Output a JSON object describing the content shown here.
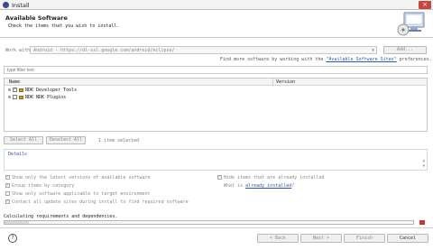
{
  "window": {
    "title": "Install",
    "close_glyph": "×"
  },
  "header": {
    "title": "Available Software",
    "subtitle": "Check the items that you wish to install."
  },
  "work_with": {
    "label": "Work with:",
    "value": "Android - https://dl-ssl.google.com/android/eclipse/",
    "add_label": "Add...",
    "find_more_prefix": "Find more software by working with the ",
    "find_more_link": "\"Available Software Sites\"",
    "find_more_suffix": " preferences."
  },
  "filter": {
    "placeholder": "type filter text"
  },
  "tree": {
    "columns": [
      "Name",
      "Version"
    ],
    "items": [
      {
        "label": "NDK Developer Tools",
        "checked": true,
        "icon": "package-icon"
      },
      {
        "label": "NDK NDK Plugins",
        "checked": false,
        "icon": "package-icon"
      }
    ]
  },
  "selection": {
    "select_all": "Select All",
    "deselect_all": "Deselect All",
    "count_text": "1 item selected"
  },
  "details": {
    "label": "Details"
  },
  "options": {
    "latest": "Show only the latest versions of available software",
    "group": "Group items by category",
    "applicable": "Show only software applicable to target environment",
    "contact": "Contact all update sites during install to find required software",
    "hide_installed": "Hide items that are already installed",
    "what_prefix": "What is ",
    "what_link": "already installed",
    "what_suffix": "?"
  },
  "status": {
    "calculating": "Calculating requirements and dependencies.",
    "progress": 0.06
  },
  "footer": {
    "help": "?",
    "back": "< Back",
    "next": "Next >",
    "finish": "Finish",
    "cancel": "Cancel"
  },
  "colors": {
    "accent": "#2a55b5",
    "stop": "#c8372d",
    "close": "#c9463d"
  }
}
